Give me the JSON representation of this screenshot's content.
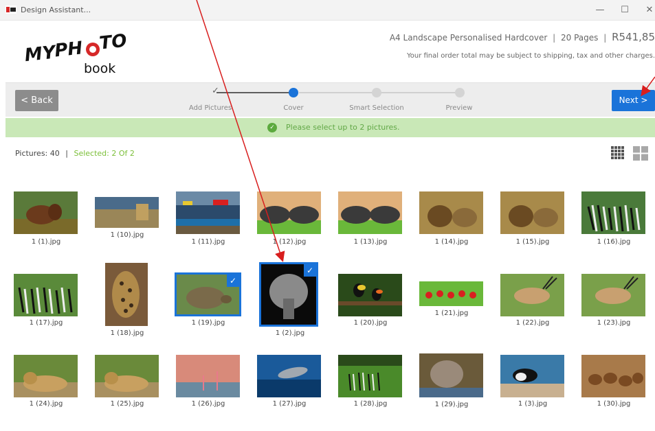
{
  "window": {
    "title": "Design Assistant...",
    "minimize_glyph": "—",
    "maximize_glyph": "☐",
    "close_glyph": "✕"
  },
  "header": {
    "logo_text_main": "MYPHOTO",
    "logo_text_sub": "book",
    "product": "A4 Landscape Personalised Hardcover",
    "pages": "20 Pages",
    "price": "R541,85",
    "separator": "|",
    "note": "Your final order total may be subject to shipping, tax and other charges."
  },
  "nav": {
    "back_label": "< Back",
    "next_label": "Next >",
    "steps": [
      {
        "label": "Add Pictures",
        "state": "done"
      },
      {
        "label": "Cover",
        "state": "current"
      },
      {
        "label": "Smart Selection",
        "state": "todo"
      },
      {
        "label": "Preview",
        "state": "todo"
      }
    ],
    "check_glyph": "✓"
  },
  "banner": {
    "icon": "check-circle-icon",
    "text": "Please select up to 2 pictures."
  },
  "counts": {
    "pictures": "Pictures: 40",
    "separator": "|",
    "selected": "Selected: 2 Of 2"
  },
  "colors": {
    "accent": "#1a73d9",
    "banner_bg": "#c9e8b7",
    "banner_text": "#62a847",
    "selected_text": "#7bbf38",
    "back_button": "#8c8c8c"
  },
  "photos": [
    {
      "name": "1 (1).jpg",
      "selected": false
    },
    {
      "name": "1 (10).jpg",
      "selected": false
    },
    {
      "name": "1 (11).jpg",
      "selected": false
    },
    {
      "name": "1 (12).jpg",
      "selected": false
    },
    {
      "name": "1 (13).jpg",
      "selected": false
    },
    {
      "name": "1 (14).jpg",
      "selected": false
    },
    {
      "name": "1 (15).jpg",
      "selected": false
    },
    {
      "name": "1 (16).jpg",
      "selected": false
    },
    {
      "name": "1 (17).jpg",
      "selected": false
    },
    {
      "name": "1 (18).jpg",
      "selected": false
    },
    {
      "name": "1 (19).jpg",
      "selected": true
    },
    {
      "name": "1 (2).jpg",
      "selected": true
    },
    {
      "name": "1 (20).jpg",
      "selected": false
    },
    {
      "name": "1 (21).jpg",
      "selected": false
    },
    {
      "name": "1 (22).jpg",
      "selected": false
    },
    {
      "name": "1 (23).jpg",
      "selected": false
    },
    {
      "name": "1 (24).jpg",
      "selected": false
    },
    {
      "name": "1 (25).jpg",
      "selected": false
    },
    {
      "name": "1 (26).jpg",
      "selected": false
    },
    {
      "name": "1 (27).jpg",
      "selected": false
    },
    {
      "name": "1 (28).jpg",
      "selected": false
    },
    {
      "name": "1 (29).jpg",
      "selected": false
    },
    {
      "name": "1 (3).jpg",
      "selected": false
    },
    {
      "name": "1 (30).jpg",
      "selected": false
    }
  ],
  "tick_glyph": "✓"
}
